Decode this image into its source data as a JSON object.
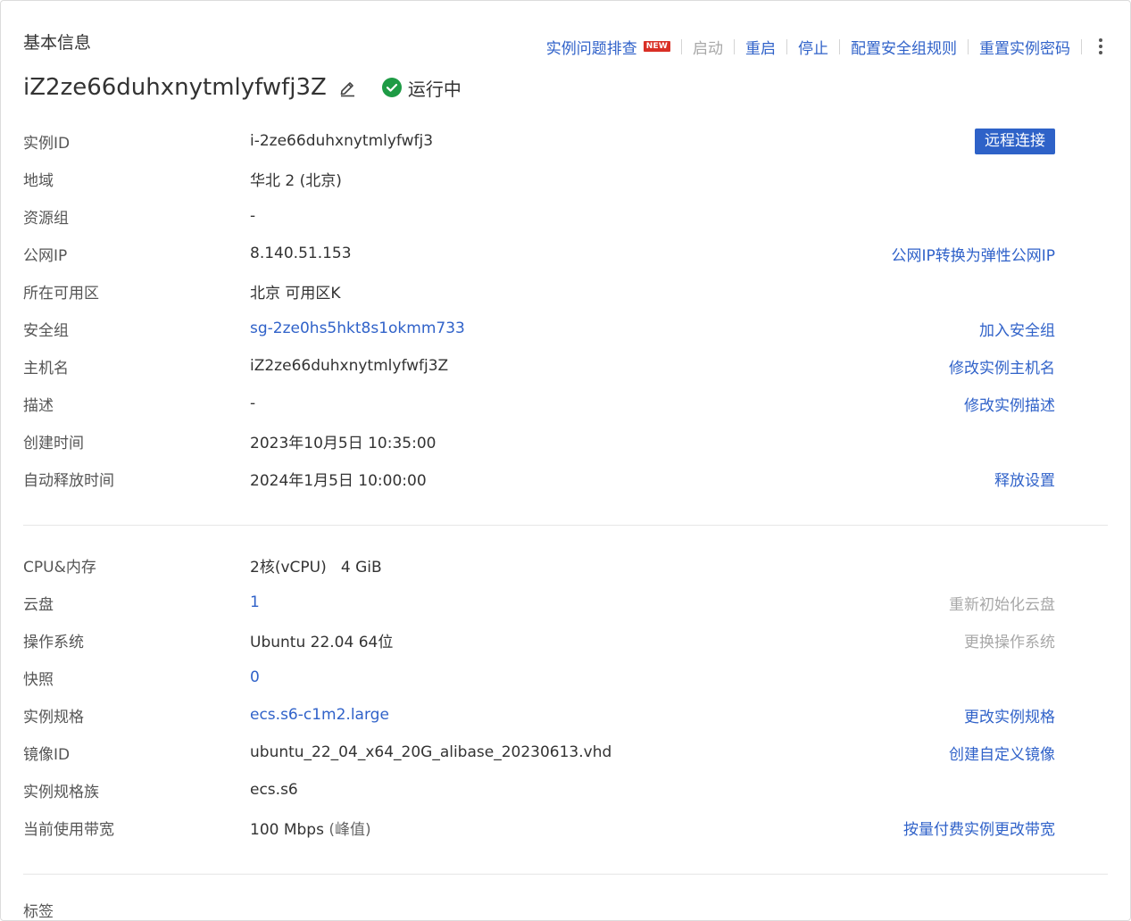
{
  "header": {
    "section_title": "基本信息",
    "actions": [
      {
        "label": "实例问题排查",
        "badge": "NEW",
        "enabled": true
      },
      {
        "label": "启动",
        "enabled": false
      },
      {
        "label": "重启",
        "enabled": true
      },
      {
        "label": "停止",
        "enabled": true
      },
      {
        "label": "配置安全组规则",
        "enabled": true
      },
      {
        "label": "重置实例密码",
        "enabled": true
      }
    ],
    "more_icon": "vertical-ellipsis-icon"
  },
  "instance": {
    "name": "iZ2ze66duhxnytmlyfwfj3Z",
    "edit_icon": "pencil-edit-icon",
    "status_icon": "check-circle-icon",
    "status": "运行中"
  },
  "basic_rows": [
    {
      "label": "实例ID",
      "value": "i-2ze66duhxnytmlyfwfj3",
      "action": "远程连接",
      "action_type": "button"
    },
    {
      "label": "地域",
      "value": "华北 2 (北京)"
    },
    {
      "label": "资源组",
      "value": "-"
    },
    {
      "label": "公网IP",
      "value": "8.140.51.153",
      "action": "公网IP转换为弹性公网IP"
    },
    {
      "label": "所在可用区",
      "value": "北京 可用区K"
    },
    {
      "label": "安全组",
      "value": "sg-2ze0hs5hkt8s1okmm733",
      "value_link": true,
      "action": "加入安全组"
    },
    {
      "label": "主机名",
      "value": "iZ2ze66duhxnytmlyfwfj3Z",
      "action": "修改实例主机名"
    },
    {
      "label": "描述",
      "value": "-",
      "action": "修改实例描述"
    },
    {
      "label": "创建时间",
      "value": "2023年10月5日 10:35:00"
    },
    {
      "label": "自动释放时间",
      "value": "2024年1月5日 10:00:00",
      "action": "释放设置"
    }
  ],
  "config_rows": [
    {
      "label": "CPU&内存",
      "value": "2核(vCPU)   4 GiB"
    },
    {
      "label": "云盘",
      "value": "1",
      "value_link": true,
      "action": "重新初始化云盘",
      "action_disabled": true
    },
    {
      "label": "操作系统",
      "value": "Ubuntu 22.04 64位",
      "action": "更换操作系统",
      "action_disabled": true
    },
    {
      "label": "快照",
      "value": "0",
      "value_link": true
    },
    {
      "label": "实例规格",
      "value": "ecs.s6-c1m2.large",
      "value_link": true,
      "action": "更改实例规格"
    },
    {
      "label": "镜像ID",
      "value": "ubuntu_22_04_x64_20G_alibase_20230613.vhd",
      "action": "创建自定义镜像"
    },
    {
      "label": "实例规格族",
      "value": "ecs.s6"
    },
    {
      "label": "当前使用带宽",
      "value": "100 Mbps",
      "value_suffix": "(峰值)",
      "action": "按量付费实例更改带宽"
    }
  ],
  "footer_partial_label": "标签",
  "colors": {
    "link": "#3062c9",
    "primary_button": "#2e62c8",
    "disabled": "#a8a8a8",
    "status_ok": "#1e9b45",
    "new_badge": "#d93026"
  }
}
